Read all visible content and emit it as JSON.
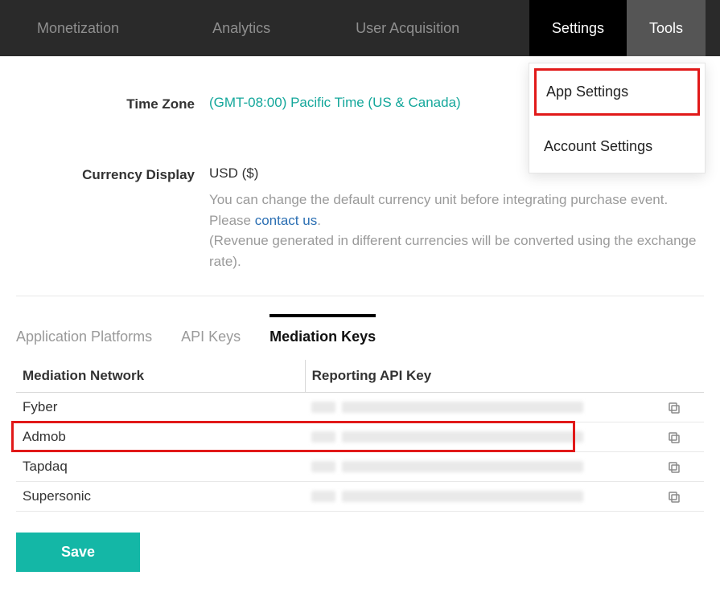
{
  "topnav": {
    "items": [
      {
        "label": "Monetization"
      },
      {
        "label": "Analytics"
      },
      {
        "label": "User Acquisition"
      },
      {
        "label": "Settings",
        "active": true
      },
      {
        "label": "Tools"
      }
    ]
  },
  "dropdown": {
    "items": [
      {
        "label": "App Settings",
        "highlight": true
      },
      {
        "label": "Account Settings"
      }
    ]
  },
  "form": {
    "timezone_label": "Time Zone",
    "timezone_value": "(GMT-08:00) Pacific Time (US & Canada)",
    "currency_label": "Currency Display",
    "currency_value": "USD ($)",
    "currency_help_1": "You can change the default currency unit before integrating purchase event. Please ",
    "currency_help_link": "contact us",
    "currency_help_1b": ".",
    "currency_help_2": "(Revenue generated in different currencies will be converted using the exchange rate)."
  },
  "tabs": {
    "items": [
      {
        "label": "Application Platforms"
      },
      {
        "label": "API Keys"
      },
      {
        "label": "Mediation Keys",
        "active": true
      }
    ]
  },
  "table": {
    "headers": {
      "network": "Mediation Network",
      "key": "Reporting API Key"
    },
    "rows": [
      {
        "network": "Fyber"
      },
      {
        "network": "Admob",
        "highlight": true
      },
      {
        "network": "Tapdaq"
      },
      {
        "network": "Supersonic"
      }
    ]
  },
  "buttons": {
    "save": "Save"
  }
}
